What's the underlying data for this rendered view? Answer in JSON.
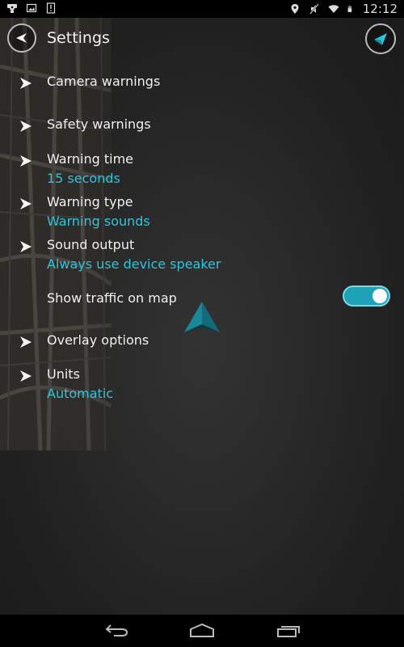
{
  "status_bar": {
    "left_icons": [
      "notification-app-icon",
      "image-icon",
      "alert-icon"
    ],
    "right_icons": [
      "location-icon",
      "mute-icon",
      "wifi-icon",
      "battery-icon"
    ],
    "time": "12:12"
  },
  "header": {
    "title": "Settings",
    "back_icon": "back-arrow-icon",
    "nav_icon": "navigation-arrow-icon"
  },
  "settings": [
    {
      "label": "Camera warnings",
      "value": null,
      "has_chevron": true
    },
    {
      "label": "Safety warnings",
      "value": null,
      "has_chevron": true
    },
    {
      "label": "Warning time",
      "value": "15 seconds",
      "has_chevron": true
    },
    {
      "label": "Warning type",
      "value": "Warning sounds",
      "has_chevron": true
    },
    {
      "label": "Sound output",
      "value": "Always use device speaker",
      "has_chevron": true
    },
    {
      "label": "Show traffic on map",
      "value": null,
      "has_chevron": false,
      "toggle": true,
      "toggle_on": true
    },
    {
      "label": "Overlay options",
      "value": null,
      "has_chevron": true
    },
    {
      "label": "Units",
      "value": "Automatic",
      "has_chevron": true
    }
  ],
  "colors": {
    "accent": "#2ec4dc",
    "toggle_on": "#1da2b8",
    "text": "#f0f0f0",
    "background": "#262626"
  },
  "nav_bar": {
    "buttons": [
      "back-icon",
      "home-icon",
      "recent-apps-icon"
    ]
  }
}
